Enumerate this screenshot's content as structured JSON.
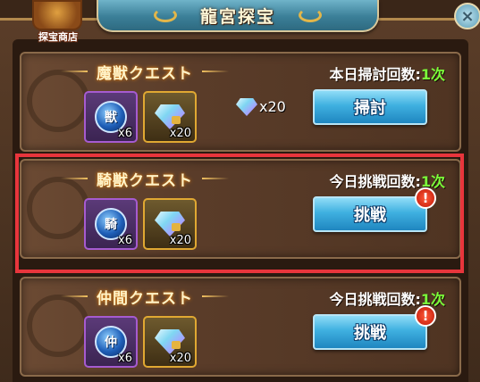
{
  "header": {
    "title": "龍宮探宝",
    "shop_label": "探宝商店",
    "close_glyph": "×"
  },
  "quests": [
    {
      "title": "魔獣クエスト",
      "counter_label": "本日掃討回数:",
      "counter_value": "1次",
      "beast_glyph": "獣",
      "beast_qty": "x6",
      "gem_qty": "x20",
      "reward_qty": "x20",
      "button_label": "掃討",
      "alert": false
    },
    {
      "title": "騎獣クエスト",
      "counter_label": "今日挑戦回数:",
      "counter_value": "1次",
      "beast_glyph": "騎",
      "beast_qty": "x6",
      "gem_qty": "x20",
      "button_label": "挑戦",
      "alert": true,
      "alert_glyph": "!"
    },
    {
      "title": "仲間クエスト",
      "counter_label": "今日挑戦回数:",
      "counter_value": "1次",
      "beast_glyph": "仲",
      "beast_qty": "x6",
      "gem_qty": "x20",
      "button_label": "挑戦",
      "alert": true,
      "alert_glyph": "!"
    }
  ],
  "colors": {
    "highlight": "#e8353c",
    "counter_value": "#7cff3a",
    "button": "#3fb0e0"
  }
}
